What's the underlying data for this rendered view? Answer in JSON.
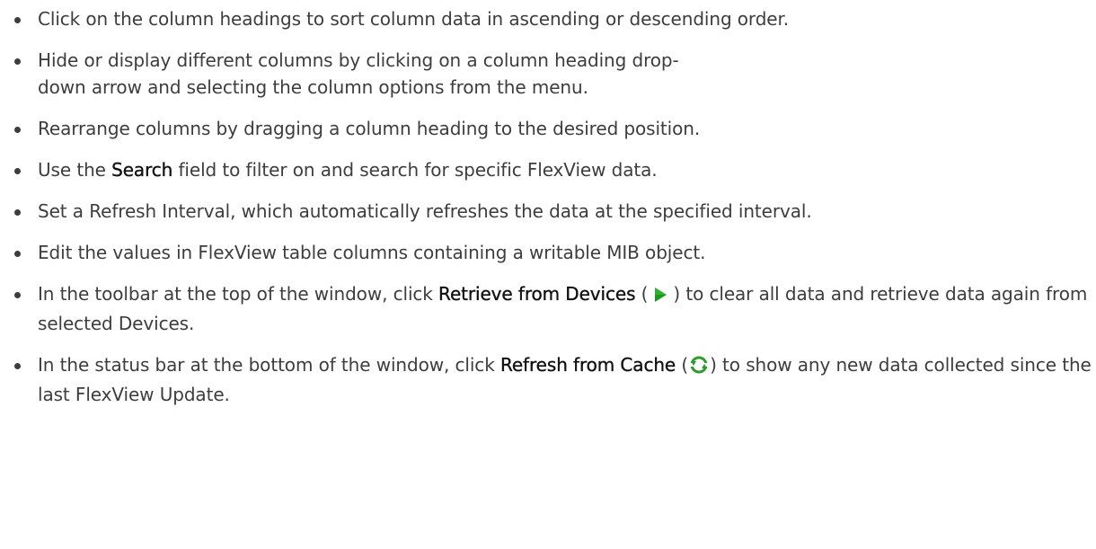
{
  "bullets": [
    {
      "text": "Click on the column headings to sort column data in ascending or descending order."
    },
    {
      "text": "Hide or display different columns by clicking on a column heading drop-down arrow and selecting the column options from the menu."
    },
    {
      "text": "Rearrange columns by dragging a column heading to the desired position."
    },
    {
      "pre": "Use the ",
      "bold": "Search",
      "post": " field to filter on and search for specific FlexView data."
    },
    {
      "text": "Set a Refresh Interval, which automatically refreshes the data at the specified interval."
    },
    {
      "text": "Edit the values in FlexView table columns containing a writable MIB object."
    },
    {
      "pre": "In the toolbar at the top of the window, click ",
      "bold": "Retrieve from Devices",
      "mid1": " (",
      "mid2": ") to clear all data and retrieve data again from selected Devices.",
      "icon": "play-icon",
      "icon_color": "#1a9a1a"
    },
    {
      "pre": "In the status bar at the bottom of the window, click ",
      "bold": "Refresh from Cache",
      "mid1": " (",
      "mid2": ") to show any new data collected since the last FlexView Update.",
      "icon": "refresh-icon",
      "icon_color": "#2f9b2f"
    }
  ]
}
